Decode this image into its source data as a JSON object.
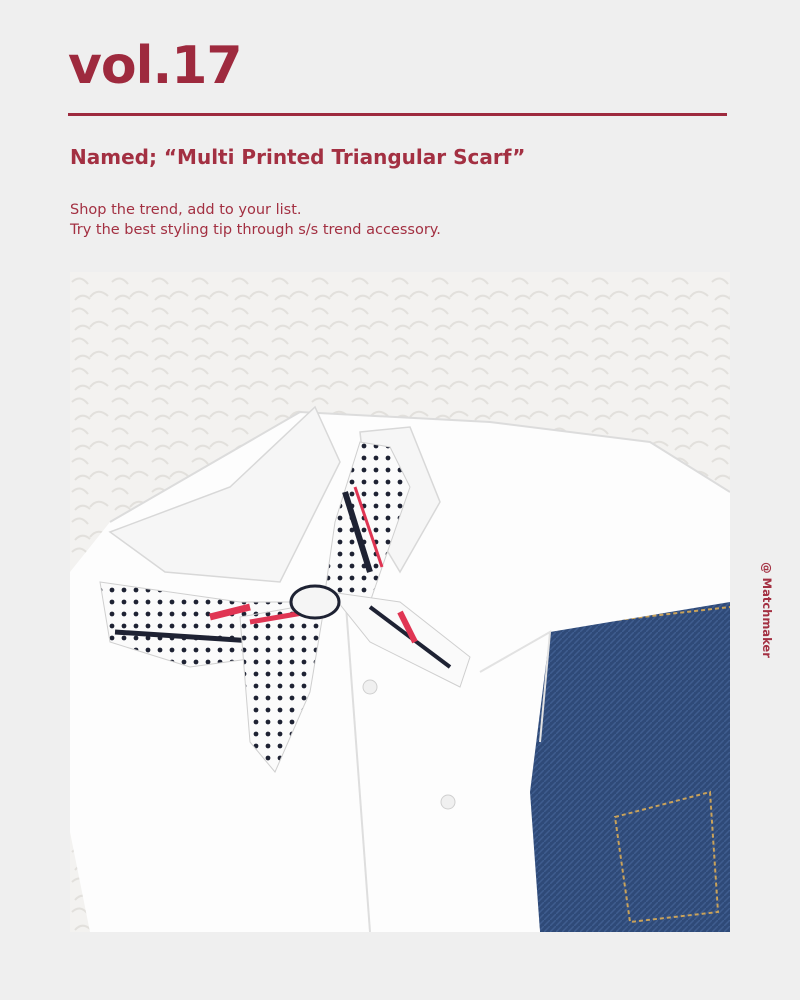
{
  "header": {
    "volume": "vol.17",
    "named": "Named;  “Multi Printed Triangular Scarf”",
    "line1": "Shop the trend, add to your list.",
    "line2": "Try the best styling tip through s/s trend accessory."
  },
  "credit": "@ Matchmaker",
  "colors": {
    "accent": "#9e2a3e",
    "background": "#efefef"
  }
}
